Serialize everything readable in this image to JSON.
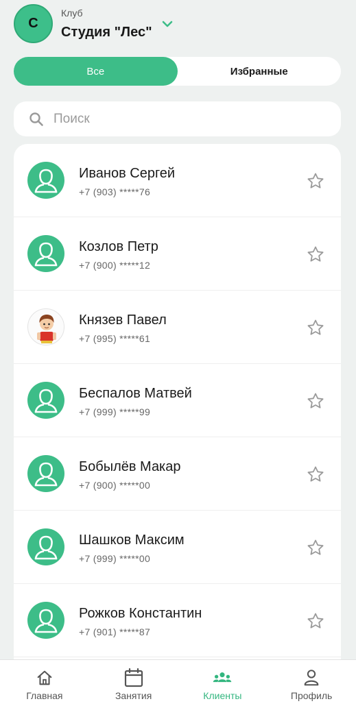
{
  "header": {
    "avatar_letter": "С",
    "club_caption": "Клуб",
    "club_name": "Студия \"Лес\""
  },
  "segmented": {
    "all_label": "Все",
    "favorites_label": "Избранные"
  },
  "search": {
    "placeholder": "Поиск",
    "value": ""
  },
  "clients": [
    {
      "name": "Иванов Сергей",
      "phone": "+7 (903) *****76",
      "avatar": "default",
      "favorite": false
    },
    {
      "name": "Козлов Петр",
      "phone": "+7 (900) *****12",
      "avatar": "default",
      "favorite": false
    },
    {
      "name": "Князев Павел",
      "phone": "+7 (995) *****61",
      "avatar": "photo",
      "favorite": false
    },
    {
      "name": "Беспалов Матвей",
      "phone": "+7 (999) *****99",
      "avatar": "default",
      "favorite": false
    },
    {
      "name": "Бобылёв Макар",
      "phone": "+7 (900) *****00",
      "avatar": "default",
      "favorite": false
    },
    {
      "name": "Шашков Максим",
      "phone": "+7 (999) *****00",
      "avatar": "default",
      "favorite": false
    },
    {
      "name": "Рожков Константин",
      "phone": "+7 (901) *****87",
      "avatar": "default",
      "favorite": false
    }
  ],
  "nav": [
    {
      "label": "Главная",
      "icon": "home-icon",
      "active": false
    },
    {
      "label": "Занятия",
      "icon": "calendar-icon",
      "active": false
    },
    {
      "label": "Клиенты",
      "icon": "clients-icon",
      "active": true
    },
    {
      "label": "Профиль",
      "icon": "profile-icon",
      "active": false
    }
  ],
  "colors": {
    "accent": "#3dbd88",
    "background": "#eef1f0",
    "star": "#9a9a9a"
  }
}
